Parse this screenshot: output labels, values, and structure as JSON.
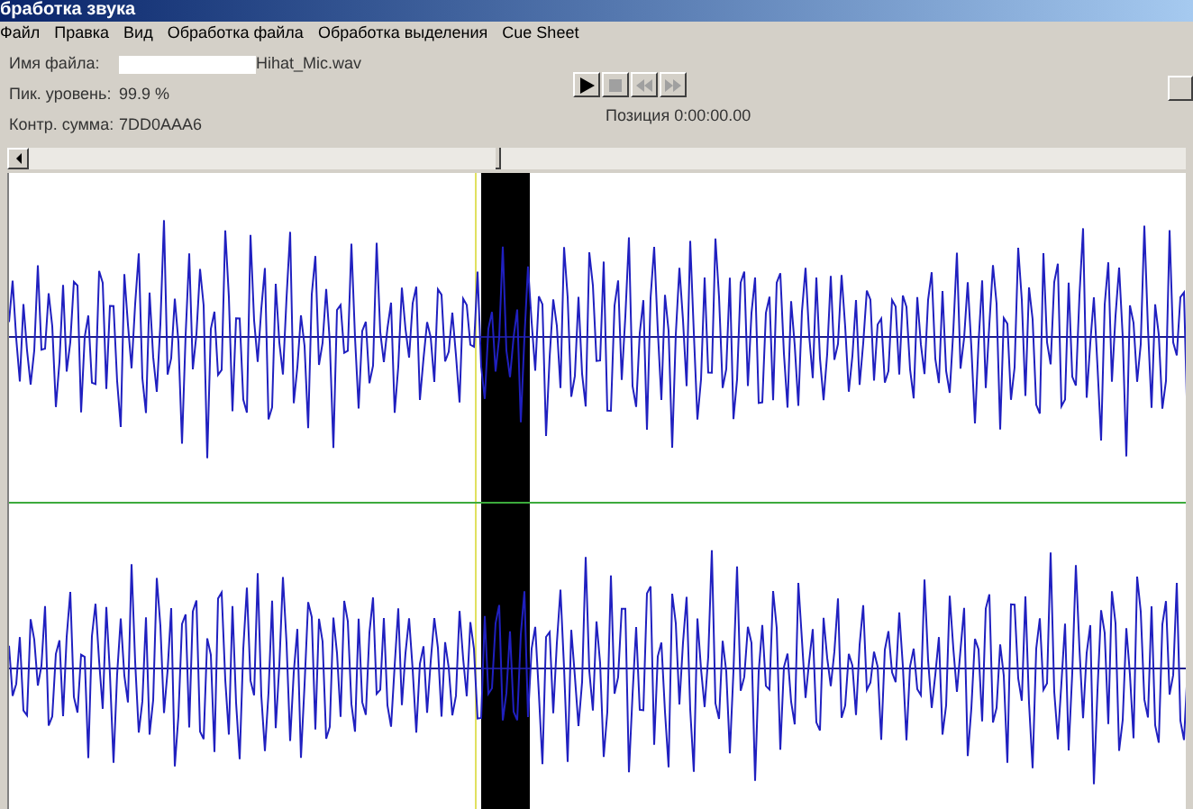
{
  "window": {
    "title": "бработка звука"
  },
  "menu": [
    "Файл",
    "Правка",
    "Вид",
    "Обработка файла",
    "Обработка выделения",
    "Cue Sheet"
  ],
  "fields": [
    {
      "label": "Имя файла:",
      "value": "Hihat_Mic.wav",
      "kind": "file"
    },
    {
      "label": "Пик. уровень:",
      "value": "99.9 %",
      "kind": "text"
    },
    {
      "label": "Контр. сумма:",
      "value": "7DD0AAA6",
      "kind": "text"
    }
  ],
  "transport": [
    {
      "kind": "play",
      "disabled": false
    },
    {
      "kind": "stop",
      "disabled": true
    },
    {
      "kind": "rewind",
      "disabled": true
    },
    {
      "kind": "forward",
      "disabled": true
    }
  ],
  "position": "Позиция 0:00:00.00"
}
